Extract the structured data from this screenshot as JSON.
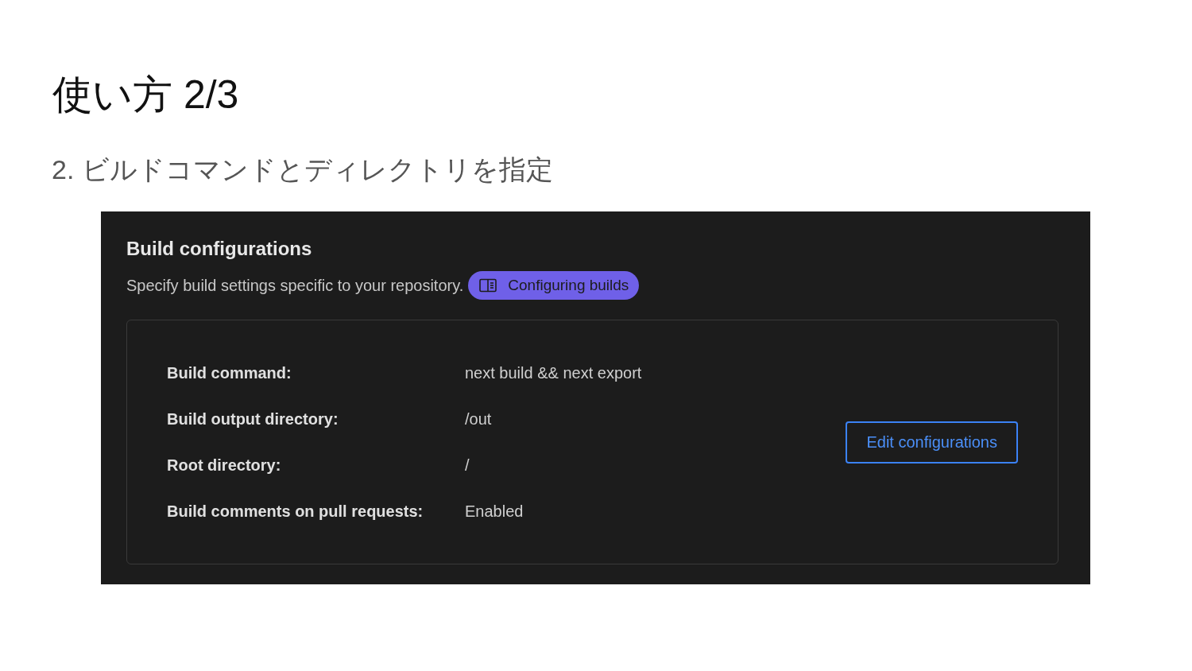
{
  "slide": {
    "title": "使い方 2/3",
    "subtitle": "2. ビルドコマンドとディレクトリを指定"
  },
  "panel": {
    "title": "Build configurations",
    "description": "Specify build settings specific to your repository.",
    "doc_link": "Configuring builds",
    "settings": [
      {
        "label": "Build command:",
        "value": "next build && next export"
      },
      {
        "label": "Build output directory:",
        "value": "/out"
      },
      {
        "label": "Root directory:",
        "value": "/"
      },
      {
        "label": "Build comments on pull requests:",
        "value": "Enabled"
      }
    ],
    "button": "Edit configurations"
  }
}
